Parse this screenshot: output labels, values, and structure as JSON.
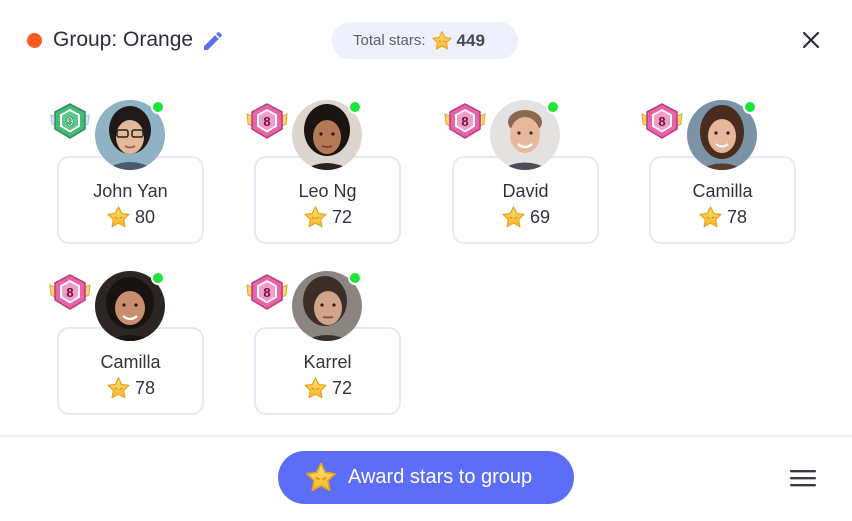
{
  "header": {
    "group_title": "Group: Orange",
    "group_color": "#ff5a26",
    "total_label": "Total stars:",
    "total_value": "449",
    "close_icon": "close-icon",
    "edit_icon": "pencil-icon"
  },
  "students": [
    {
      "name": "John Yan",
      "stars": "80",
      "level": "9",
      "online": true
    },
    {
      "name": "Leo Ng",
      "stars": "72",
      "level": "8",
      "online": true
    },
    {
      "name": "David",
      "stars": "69",
      "level": "8",
      "online": true
    },
    {
      "name": "Camilla",
      "stars": "78",
      "level": "8",
      "online": true
    },
    {
      "name": "Camilla",
      "stars": "78",
      "level": "8",
      "online": true
    },
    {
      "name": "Karrel",
      "stars": "72",
      "level": "8",
      "online": true
    }
  ],
  "footer": {
    "award_label": "Award stars to group",
    "award_color": "#5b6ef5",
    "menu_icon": "hamburger-menu-icon"
  },
  "colors": {
    "level9_badge": "#3aa56b",
    "level8_badge": "#e04fa0",
    "online": "#1ee338"
  }
}
